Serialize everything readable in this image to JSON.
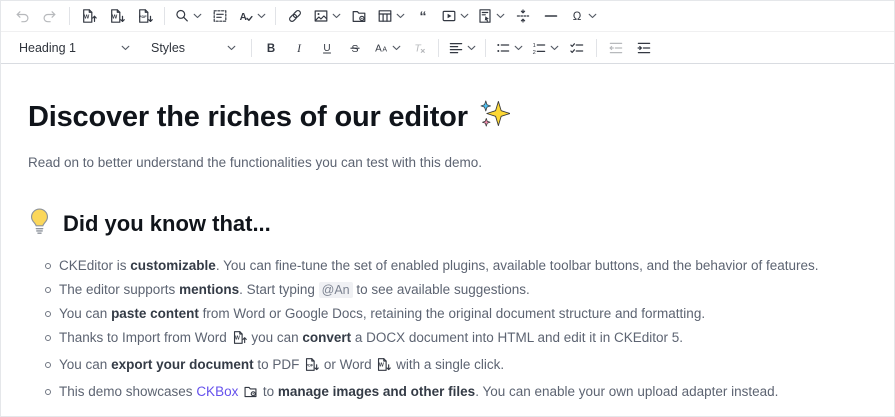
{
  "colors": {
    "link": "#6551ec",
    "toolbar_icon": "#333842",
    "body_text": "#5d6472",
    "heading_text": "#10141a",
    "mention_bg": "#f0f1f4"
  },
  "toolbar": {
    "rows": [
      {
        "groups": [
          {
            "buttons": [
              {
                "name": "undo",
                "icon": "undo",
                "disabled": true
              },
              {
                "name": "redo",
                "icon": "redo",
                "disabled": true
              }
            ]
          },
          {
            "buttons": [
              {
                "name": "import-from-word",
                "icon": "import-word"
              },
              {
                "name": "export-to-word",
                "icon": "export-word"
              },
              {
                "name": "export-to-pdf",
                "icon": "export-pdf"
              }
            ]
          },
          {
            "buttons": [
              {
                "name": "find-and-replace",
                "icon": "find-replace",
                "dropdown": true
              },
              {
                "name": "select-all",
                "icon": "select-all"
              },
              {
                "name": "proofread",
                "icon": "proofread",
                "dropdown": true
              }
            ]
          },
          {
            "buttons": [
              {
                "name": "link",
                "icon": "link"
              },
              {
                "name": "insert-image",
                "icon": "image",
                "dropdown": true
              },
              {
                "name": "ckbox-file-manager",
                "icon": "ckbox"
              },
              {
                "name": "insert-table",
                "icon": "table",
                "dropdown": true
              },
              {
                "name": "block-quote",
                "icon": "block-quote"
              },
              {
                "name": "insert-media",
                "icon": "media-embed",
                "dropdown": true
              },
              {
                "name": "insert-template",
                "icon": "template",
                "dropdown": true
              },
              {
                "name": "page-break",
                "icon": "page-break"
              },
              {
                "name": "horizontal-line",
                "icon": "horizontal-line"
              },
              {
                "name": "special-characters",
                "icon": "special-characters",
                "dropdown": true
              }
            ]
          }
        ]
      },
      {
        "groups": [
          {
            "buttons": [
              {
                "name": "heading-dropdown",
                "type": "select",
                "label": "Heading 1",
                "width": 128,
                "dropdown": true
              },
              {
                "name": "styles-dropdown",
                "type": "select",
                "label": "Styles",
                "width": 102,
                "dropdown": true
              }
            ]
          },
          {
            "buttons": [
              {
                "name": "bold",
                "icon": "bold"
              },
              {
                "name": "italic",
                "icon": "italic"
              },
              {
                "name": "underline",
                "icon": "underline"
              },
              {
                "name": "strikethrough",
                "icon": "strikethrough"
              },
              {
                "name": "font-family",
                "icon": "font",
                "dropdown": true
              },
              {
                "name": "remove-format",
                "icon": "remove-format",
                "disabled": true
              }
            ]
          },
          {
            "buttons": [
              {
                "name": "text-alignment",
                "icon": "align-left",
                "dropdown": true
              }
            ]
          },
          {
            "buttons": [
              {
                "name": "bulleted-list",
                "icon": "bulleted-list",
                "dropdown": true
              },
              {
                "name": "numbered-list",
                "icon": "numbered-list",
                "dropdown": true
              },
              {
                "name": "todo-list",
                "icon": "todo-list"
              }
            ]
          },
          {
            "buttons": [
              {
                "name": "outdent",
                "icon": "outdent",
                "disabled": true
              },
              {
                "name": "indent",
                "icon": "indent"
              }
            ]
          }
        ]
      }
    ]
  },
  "content": {
    "title": "Discover the riches of our editor",
    "title_emoji": "sparkles",
    "intro": "Read on to better understand the functionalities you can test with this demo.",
    "section_heading": "Did you know that...",
    "section_emoji": "lightbulb",
    "bullets": [
      [
        {
          "text": "CKEditor is "
        },
        {
          "text": "customizable",
          "style": "bold"
        },
        {
          "text": ". You can fine-tune the set of enabled plugins, available toolbar buttons, and the behavior of features."
        }
      ],
      [
        {
          "text": "The editor supports "
        },
        {
          "text": "mentions",
          "style": "bold"
        },
        {
          "text": ". Start typing "
        },
        {
          "text": "@An",
          "style": "code"
        },
        {
          "text": " to see available suggestions."
        }
      ],
      [
        {
          "text": "You can "
        },
        {
          "text": "paste content",
          "style": "bold"
        },
        {
          "text": " from Word or Google Docs, retaining the original document structure and formatting."
        }
      ],
      [
        {
          "text": "Thanks to Import from Word "
        },
        {
          "icon": "import-word"
        },
        {
          "text": " you can "
        },
        {
          "text": "convert",
          "style": "bold"
        },
        {
          "text": " a DOCX document into HTML and edit it in CKEditor 5."
        }
      ],
      [
        {
          "text": "You can "
        },
        {
          "text": "export your document",
          "style": "bold"
        },
        {
          "text": " to PDF "
        },
        {
          "icon": "export-pdf"
        },
        {
          "text": " or Word "
        },
        {
          "icon": "export-word"
        },
        {
          "text": " with a single click."
        }
      ],
      [
        {
          "text": "This demo showcases "
        },
        {
          "text": "CKBox",
          "style": "link"
        },
        {
          "text": " "
        },
        {
          "icon": "ckbox"
        },
        {
          "text": " to "
        },
        {
          "text": "manage images and other files",
          "style": "bold"
        },
        {
          "text": ". You can enable your own upload adapter instead."
        }
      ]
    ]
  }
}
